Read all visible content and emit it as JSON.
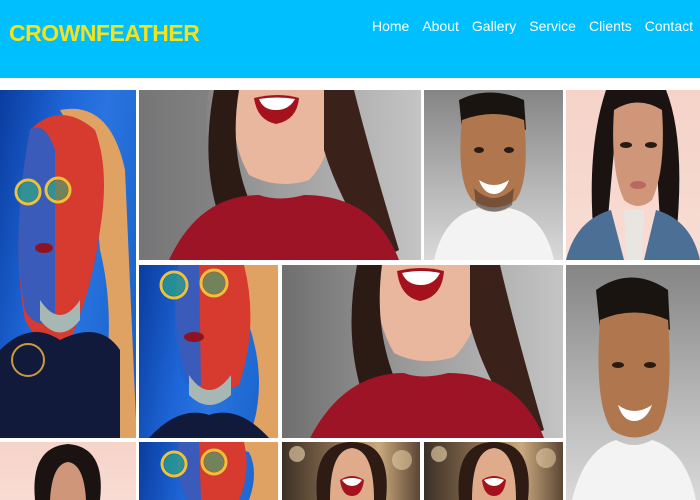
{
  "brand": {
    "name": "CROWNFEATHER",
    "color": "#f5e21c"
  },
  "header": {
    "background": "#00bfff"
  },
  "nav": {
    "items": [
      {
        "label": "Home"
      },
      {
        "label": "About"
      },
      {
        "label": "Gallery"
      },
      {
        "label": "Service"
      },
      {
        "label": "Clients"
      },
      {
        "label": "Contact"
      }
    ]
  },
  "gallery": {
    "photos": [
      {
        "subject": "woman with round glasses in red and blue light"
      },
      {
        "subject": "smiling woman in red sweater, cropped at mouth"
      },
      {
        "subject": "smiling man in white t-shirt"
      },
      {
        "subject": "woman in denim jacket, pink background"
      },
      {
        "subject": "woman with round glasses in red and blue light"
      },
      {
        "subject": "smiling woman in red sweater, cropped at mouth"
      },
      {
        "subject": "smiling man in white t-shirt"
      },
      {
        "subject": "woman with dark hair, pink background"
      },
      {
        "subject": "woman with round glasses in red and blue light"
      },
      {
        "subject": "laughing woman with bokeh background"
      },
      {
        "subject": "laughing woman with bokeh background"
      }
    ]
  }
}
